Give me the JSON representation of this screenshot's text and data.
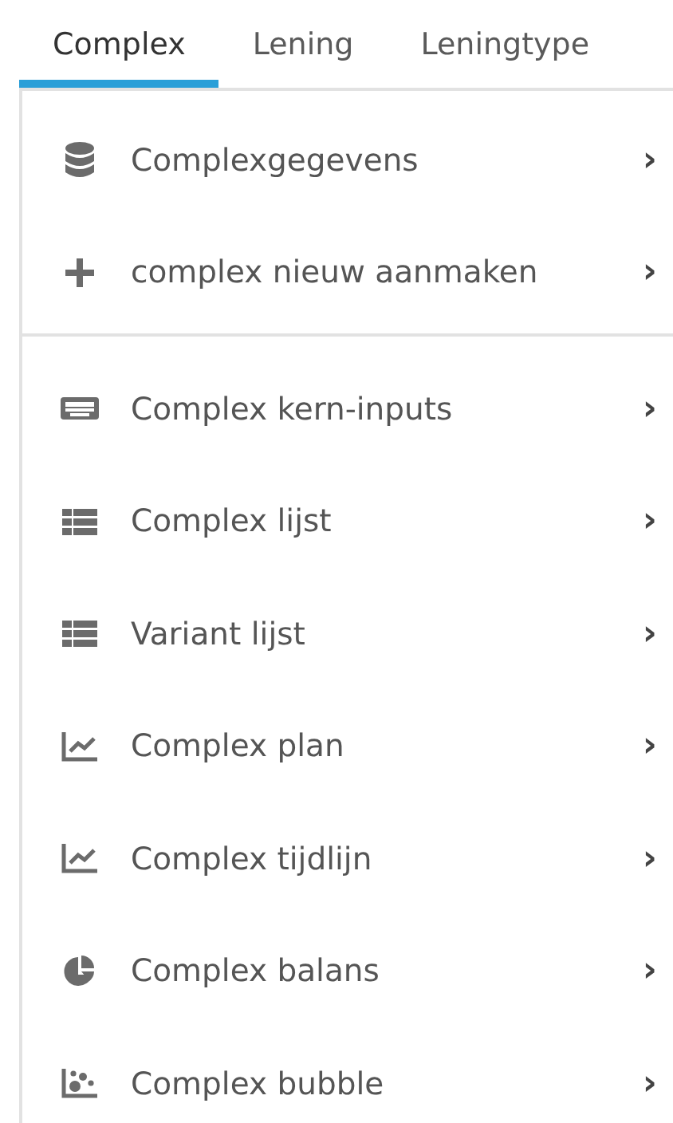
{
  "tabs": [
    {
      "label": "Complex",
      "selected": true
    },
    {
      "label": "Lening",
      "selected": false
    },
    {
      "label": "Leningtype",
      "selected": false
    }
  ],
  "menu": {
    "sections": [
      [
        {
          "label": "Complexgegevens",
          "chevron": "›"
        },
        {
          "label": "complex nieuw aanmaken",
          "chevron": "›"
        }
      ],
      [
        {
          "label": "Complex kern-inputs",
          "chevron": "›"
        },
        {
          "label": "Complex lijst",
          "chevron": "›"
        },
        {
          "label": "Variant lijst",
          "chevron": "›"
        },
        {
          "label": "Complex plan",
          "chevron": "›"
        },
        {
          "label": "Complex tijdlijn",
          "chevron": "›"
        },
        {
          "label": "Complex balans",
          "chevron": "›"
        },
        {
          "label": "Complex bubble",
          "chevron": "›"
        }
      ]
    ]
  }
}
